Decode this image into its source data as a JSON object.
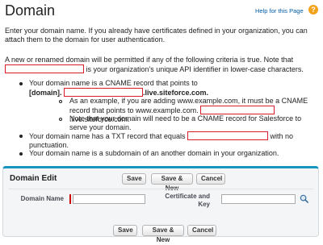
{
  "header": {
    "title": "Domain",
    "help_link": "Help for this Page",
    "help_icon": "?"
  },
  "intro": "Enter your domain name. If you already have certificates defined in your organization, you can attach them to the domain for user authentication.",
  "criteria": {
    "intro_before": "A new or renamed domain will be permitted if any of the following criteria is true. Note that",
    "intro_after": "is your organization's unique API identifier in lower-case characters.",
    "cname_before": "Your domain name is a CNAME record that points to",
    "cname_domain_prefix": "[domain].",
    "cname_domain_suffix": ".live.siteforce.com.",
    "example_before": "As an example, if you are adding www.example.com, it must be a CNAME record that points to www.example.com.",
    "example_after": ".live.siteforce.com.",
    "note": "Note that your domain will need to be a CNAME record for Salesforce to serve your domain.",
    "txt_before": "Your domain name has a TXT record that equals",
    "txt_after": "with no punctuation.",
    "subdomain": "Your domain name is a subdomain of an another domain in your organization."
  },
  "edit_panel": {
    "title": "Domain Edit",
    "buttons": {
      "save": "Save",
      "save_new": "Save & New",
      "cancel": "Cancel"
    },
    "fields": {
      "domain_name_label": "Domain Name",
      "domain_name_value": "",
      "certificate_label_line1": "Certificate and",
      "certificate_label_line2": "Key",
      "certificate_value": ""
    },
    "lookup_icon": "magnifier-lookup-icon"
  },
  "colors": {
    "accent": "#1797c0",
    "redaction": "#d81d2a",
    "link": "#015ba7",
    "help_icon": "#f2a31b"
  }
}
